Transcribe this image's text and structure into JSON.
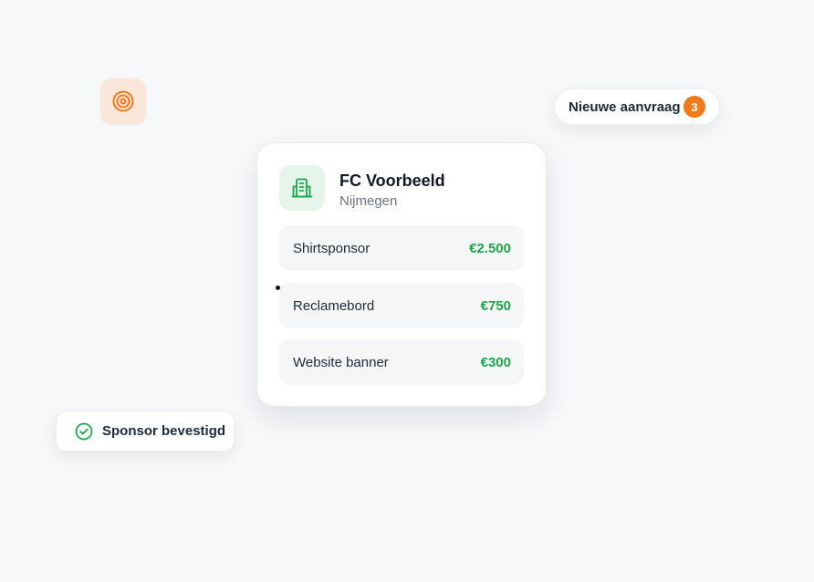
{
  "notification": {
    "label": "Nieuwe aanvraag",
    "count": "3"
  },
  "club": {
    "name": "FC Voorbeeld",
    "city": "Nijmegen",
    "packages": [
      {
        "name": "Shirtsponsor",
        "price": "€2.500"
      },
      {
        "name": "Reclamebord",
        "price": "€750"
      },
      {
        "name": "Website banner",
        "price": "€300"
      }
    ]
  },
  "confirmation": {
    "label": "Sponsor bevestigd"
  },
  "icons": {
    "target": "target-icon",
    "building": "building-icon",
    "check": "check-circle-icon"
  },
  "colors": {
    "accent_orange": "#f27a1a",
    "accent_green": "#1fa34a",
    "background": "#f7f8fa"
  }
}
